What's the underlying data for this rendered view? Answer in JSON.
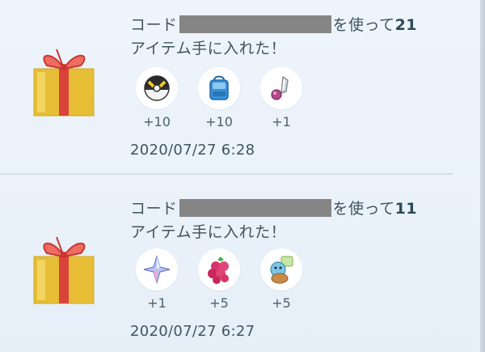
{
  "rewards": [
    {
      "msg_prefix": "コード",
      "msg_middle": "を使って",
      "count": "21",
      "msg_suffix": "アイテム手に入れた！",
      "items": [
        {
          "icon": "ultra-ball-icon",
          "qty": "+10"
        },
        {
          "icon": "item-bag-upgrade-icon",
          "qty": "+10"
        },
        {
          "icon": "incense-icon",
          "qty": "+1"
        }
      ],
      "date": "2020/07/27 6:28"
    },
    {
      "msg_prefix": "コード",
      "msg_middle": "を使って",
      "count": "11",
      "msg_suffix": "アイテム手に入れた！",
      "items": [
        {
          "icon": "star-piece-icon",
          "qty": "+1"
        },
        {
          "icon": "razz-berry-icon",
          "qty": "+5"
        },
        {
          "icon": "squirtle-candy-icon",
          "qty": "+5"
        }
      ],
      "date": "2020/07/27 6:27"
    }
  ],
  "colors": {
    "gift_gold": "#e8c13b",
    "ribbon": "#d9433c",
    "mask": "#858585"
  }
}
